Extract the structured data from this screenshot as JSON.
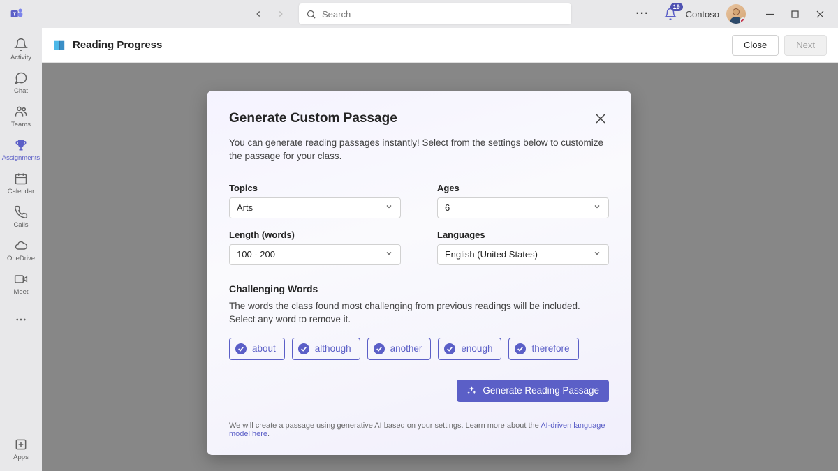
{
  "titlebar": {
    "search_placeholder": "Search",
    "notif_count": "19",
    "tenant": "Contoso"
  },
  "rail": {
    "items": [
      {
        "label": "Activity"
      },
      {
        "label": "Chat"
      },
      {
        "label": "Teams"
      },
      {
        "label": "Assignments"
      },
      {
        "label": "Calendar"
      },
      {
        "label": "Calls"
      },
      {
        "label": "OneDrive"
      },
      {
        "label": "Meet"
      }
    ],
    "apps_label": "Apps"
  },
  "header": {
    "title": "Reading Progress",
    "close_label": "Close",
    "next_label": "Next"
  },
  "modal": {
    "title": "Generate Custom Passage",
    "description": "You can generate reading passages instantly! Select from the settings below to customize the passage for your class.",
    "fields": {
      "topics": {
        "label": "Topics",
        "value": "Arts"
      },
      "ages": {
        "label": "Ages",
        "value": "6"
      },
      "length": {
        "label": "Length (words)",
        "value": "100 - 200"
      },
      "languages": {
        "label": "Languages",
        "value": "English (United States)"
      }
    },
    "challenging": {
      "title": "Challenging Words",
      "description": "The words the class found most challenging from previous readings will be included. Select any word to remove it.",
      "words": [
        "about",
        "although",
        "another",
        "enough",
        "therefore"
      ]
    },
    "generate_label": "Generate Reading Passage",
    "footer_text": "We will create a passage using generative AI based on your settings. Learn more about the ",
    "footer_link": "AI-driven language model here"
  }
}
